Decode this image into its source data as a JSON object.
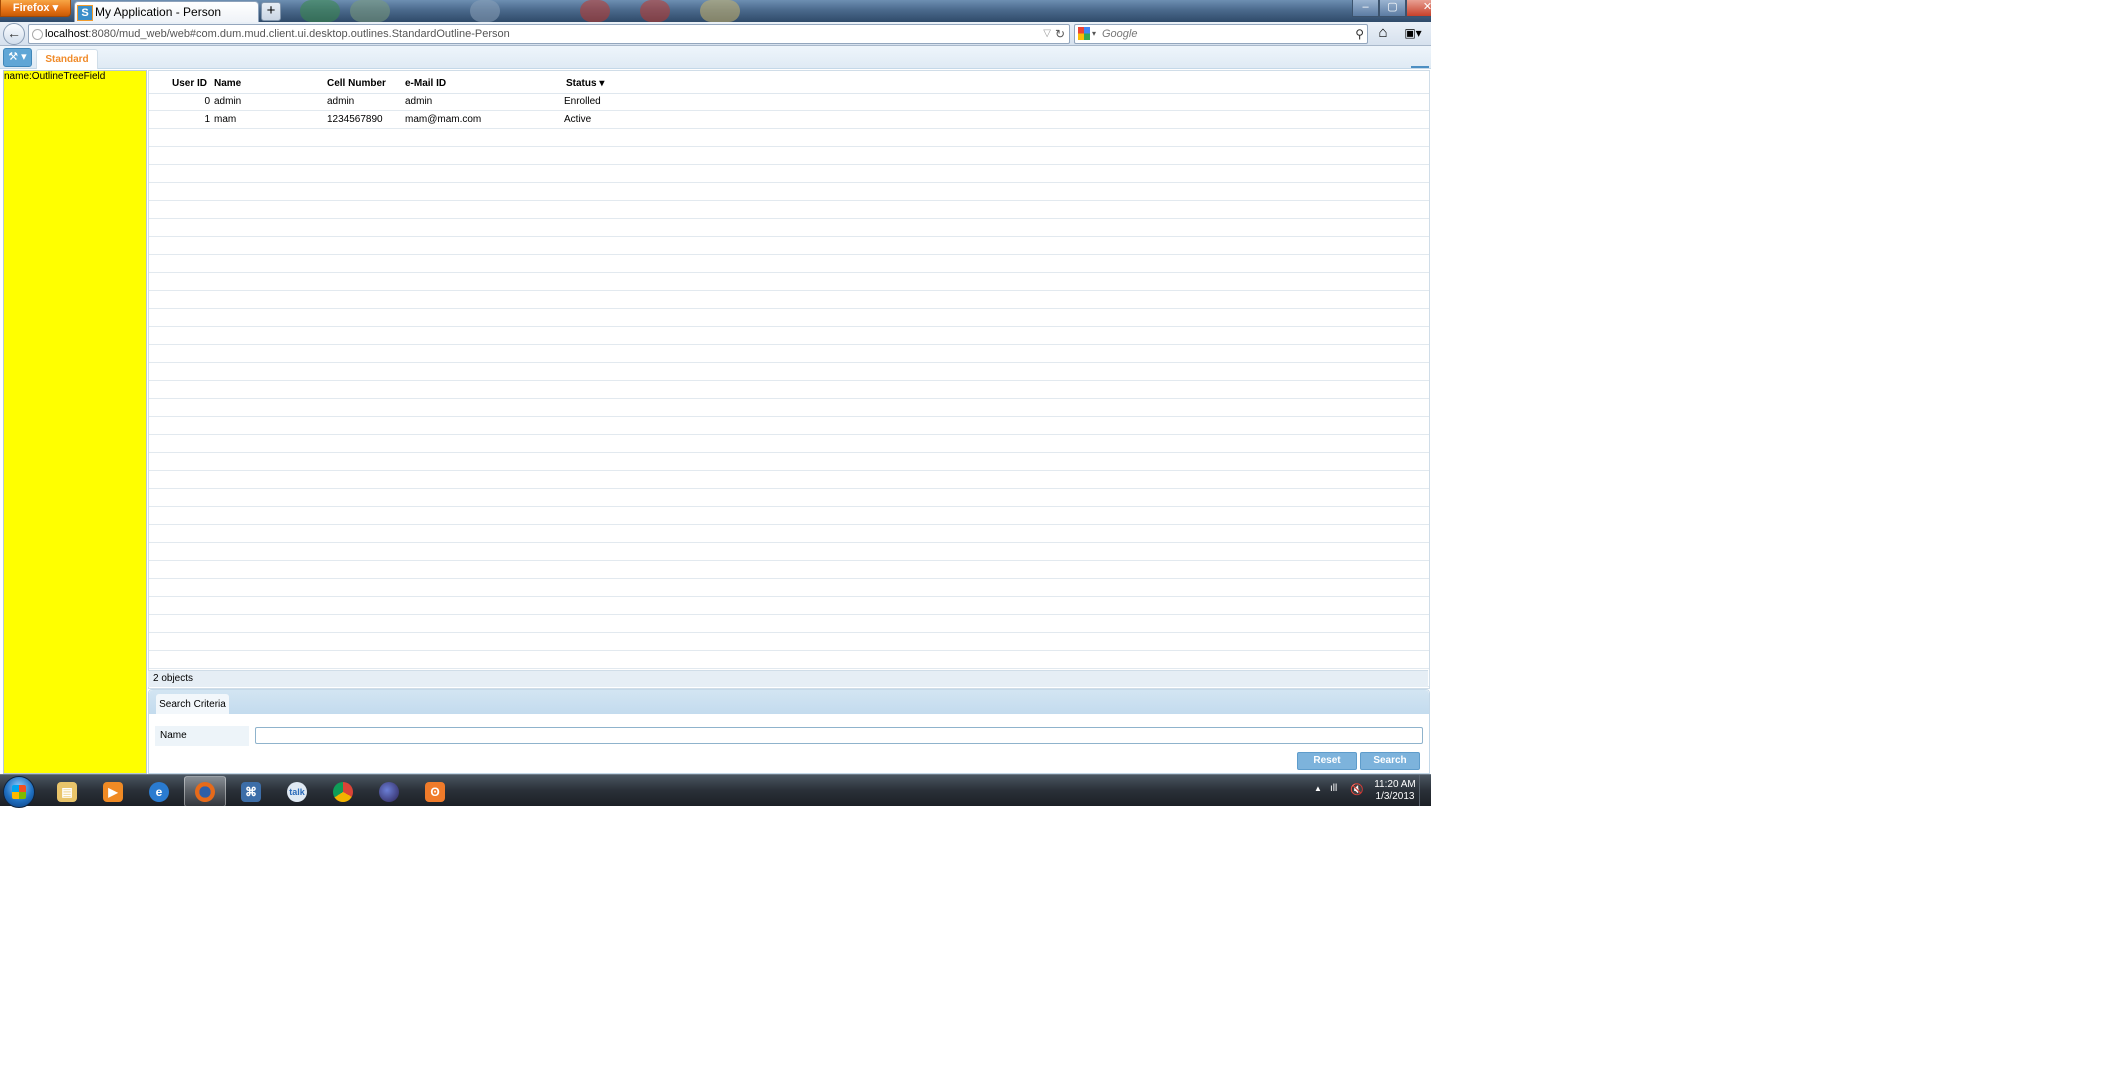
{
  "browser": {
    "menu_label": "Firefox ▾",
    "tab_title": "My Application - Person",
    "tab_favicon": "S",
    "new_tab_label": "+",
    "url_host": "localhost",
    "url_rest": ":8080/mud_web/web#com.dum.mud.client.ui.desktop.outlines.StandardOutline-Person",
    "search_placeholder": "Google",
    "window_buttons": {
      "minimize": "–",
      "maximize": "▢",
      "close": "✕"
    }
  },
  "app": {
    "tools_label": "⚒ ▾",
    "outline_tab_label": "Standard",
    "tree_label": "name:OutlineTreeField",
    "table": {
      "columns": [
        {
          "key": "user_id",
          "label": "User ID"
        },
        {
          "key": "name",
          "label": "Name"
        },
        {
          "key": "cell_number",
          "label": "Cell Number"
        },
        {
          "key": "email",
          "label": "e-Mail ID"
        },
        {
          "key": "status",
          "label": "Status ▾"
        }
      ],
      "rows": [
        {
          "user_id": "0",
          "name": "admin",
          "cell_number": "admin",
          "email": "admin",
          "status": "Enrolled"
        },
        {
          "user_id": "1",
          "name": "mam",
          "cell_number": "1234567890",
          "email": "mam@mam.com",
          "status": "Active"
        }
      ]
    },
    "status_text": "2 objects",
    "search": {
      "tab_label": "Search Criteria",
      "name_label": "Name",
      "name_value": "",
      "reset_label": "Reset",
      "search_label": "Search"
    }
  },
  "taskbar": {
    "apps": [
      "explorer",
      "media-player",
      "internet-explorer",
      "firefox",
      "network",
      "google-talk",
      "chrome",
      "eclipse",
      "xampp"
    ],
    "time": "11:20 AM",
    "date": "1/3/2013"
  },
  "colors": {
    "tree_bg": "#ffff00",
    "outline_tab_text": "#f08b2a",
    "button_bg": "#7db3dc"
  }
}
